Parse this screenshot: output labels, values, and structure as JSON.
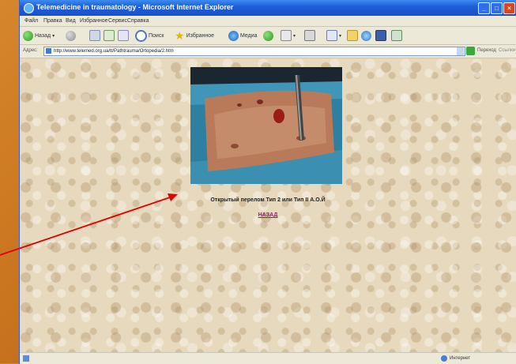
{
  "window": {
    "title": "Telemedicine in traumatology - Microsoft Internet Explorer"
  },
  "menubar": {
    "items": [
      "Файл",
      "Правка",
      "Вид",
      "Избранное",
      "Сервис",
      "Справка"
    ]
  },
  "toolbar": {
    "back_label": "Назад",
    "search_label": "Поиск",
    "favorites_label": "Избранное",
    "media_label": "Медиа"
  },
  "address": {
    "label": "Адрес:",
    "url": "http://www.telemed.org.ua/tt/Pathtrauma/Ortopedia/2.htm",
    "go_label": "Переход",
    "links_label": "Ссылки"
  },
  "content": {
    "caption": "Открытый перелом Тип 2 или Тип II А.О.Й",
    "back_link": "НАЗАД"
  },
  "statusbar": {
    "zone": "Интернет"
  },
  "colors": {
    "titlebar": "#1f5fd9",
    "link": "#8a1f7a",
    "arrow": "#e00000",
    "desktop": "#c9741f"
  }
}
